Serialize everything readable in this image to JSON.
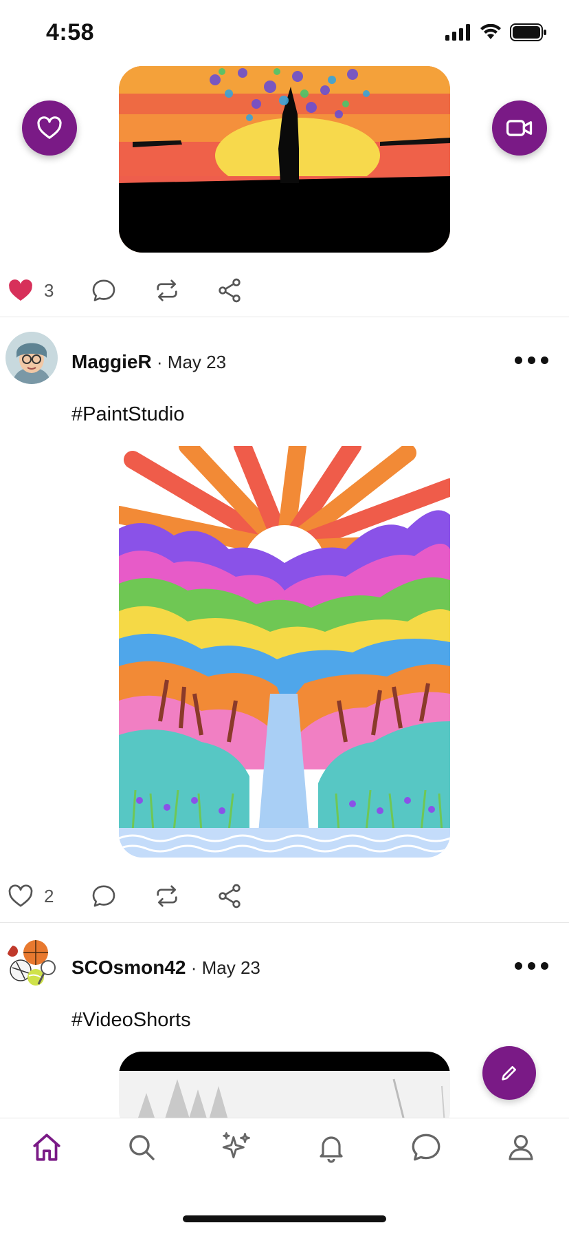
{
  "status_bar": {
    "time": "4:58"
  },
  "posts": [
    {
      "like_count": "3",
      "liked": true
    },
    {
      "username": "MaggieR",
      "date": " · May 23",
      "hashtag": "#PaintStudio",
      "like_count": "2",
      "liked": false
    },
    {
      "username": "SCOsmon42",
      "date": " · May 23",
      "hashtag": "#VideoShorts"
    }
  ],
  "colors": {
    "accent": "#7a1a86",
    "like_red": "#d7305a"
  },
  "icons": [
    "heart-icon",
    "video-icon",
    "comment-icon",
    "repost-icon",
    "share-icon",
    "more-icon",
    "pencil-icon",
    "home-icon",
    "search-icon",
    "sparkles-icon",
    "bell-icon",
    "chat-icon",
    "profile-icon"
  ]
}
